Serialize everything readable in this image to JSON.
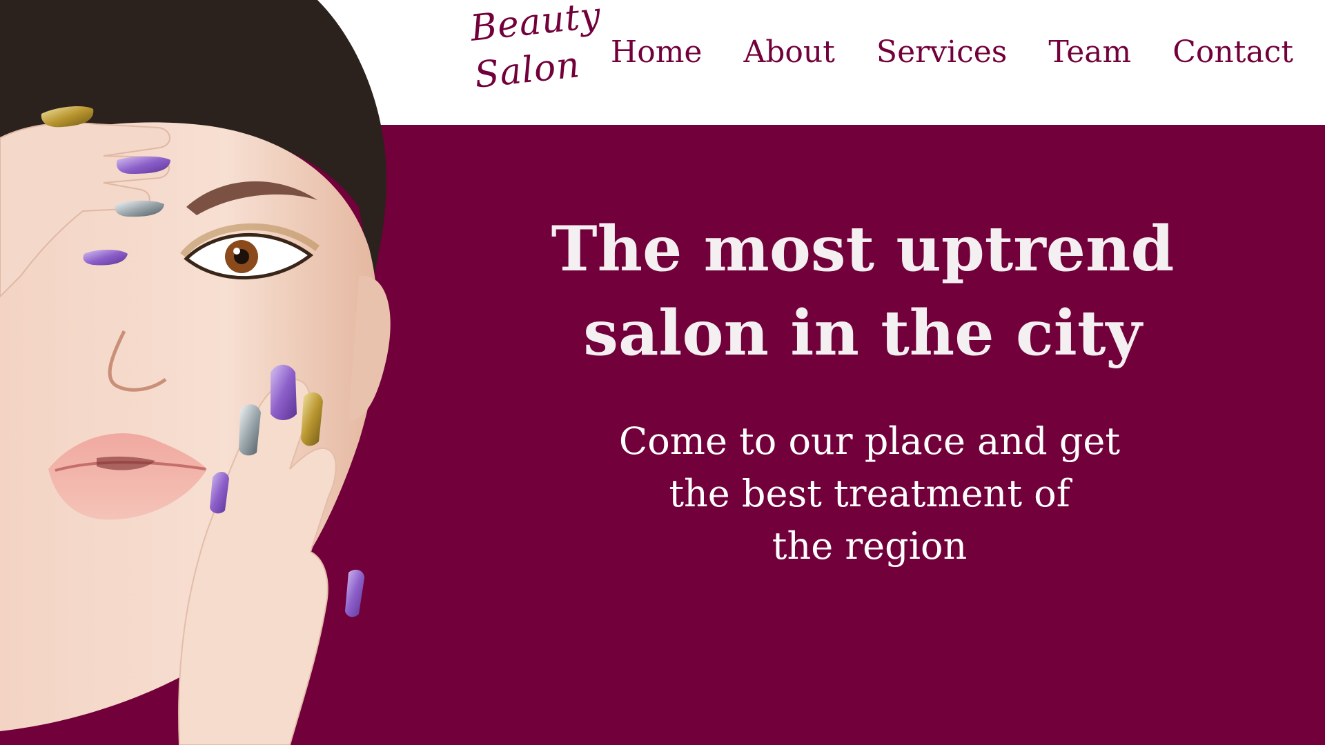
{
  "brand": {
    "logo_line1": "Beauty",
    "logo_line2": "Salon"
  },
  "nav": {
    "items": [
      {
        "label": "Home"
      },
      {
        "label": "About"
      },
      {
        "label": "Services"
      },
      {
        "label": "Team"
      },
      {
        "label": "Contact"
      }
    ]
  },
  "hero": {
    "headline_line1": "The most uptrend",
    "headline_line2": "salon in the city",
    "subtext_line1": "Come to our place and get",
    "subtext_line2": "the best treatment of",
    "subtext_line3": "the region"
  },
  "colors": {
    "accent": "#72003a",
    "background": "#ffffff",
    "text_on_accent": "#ffffff"
  }
}
